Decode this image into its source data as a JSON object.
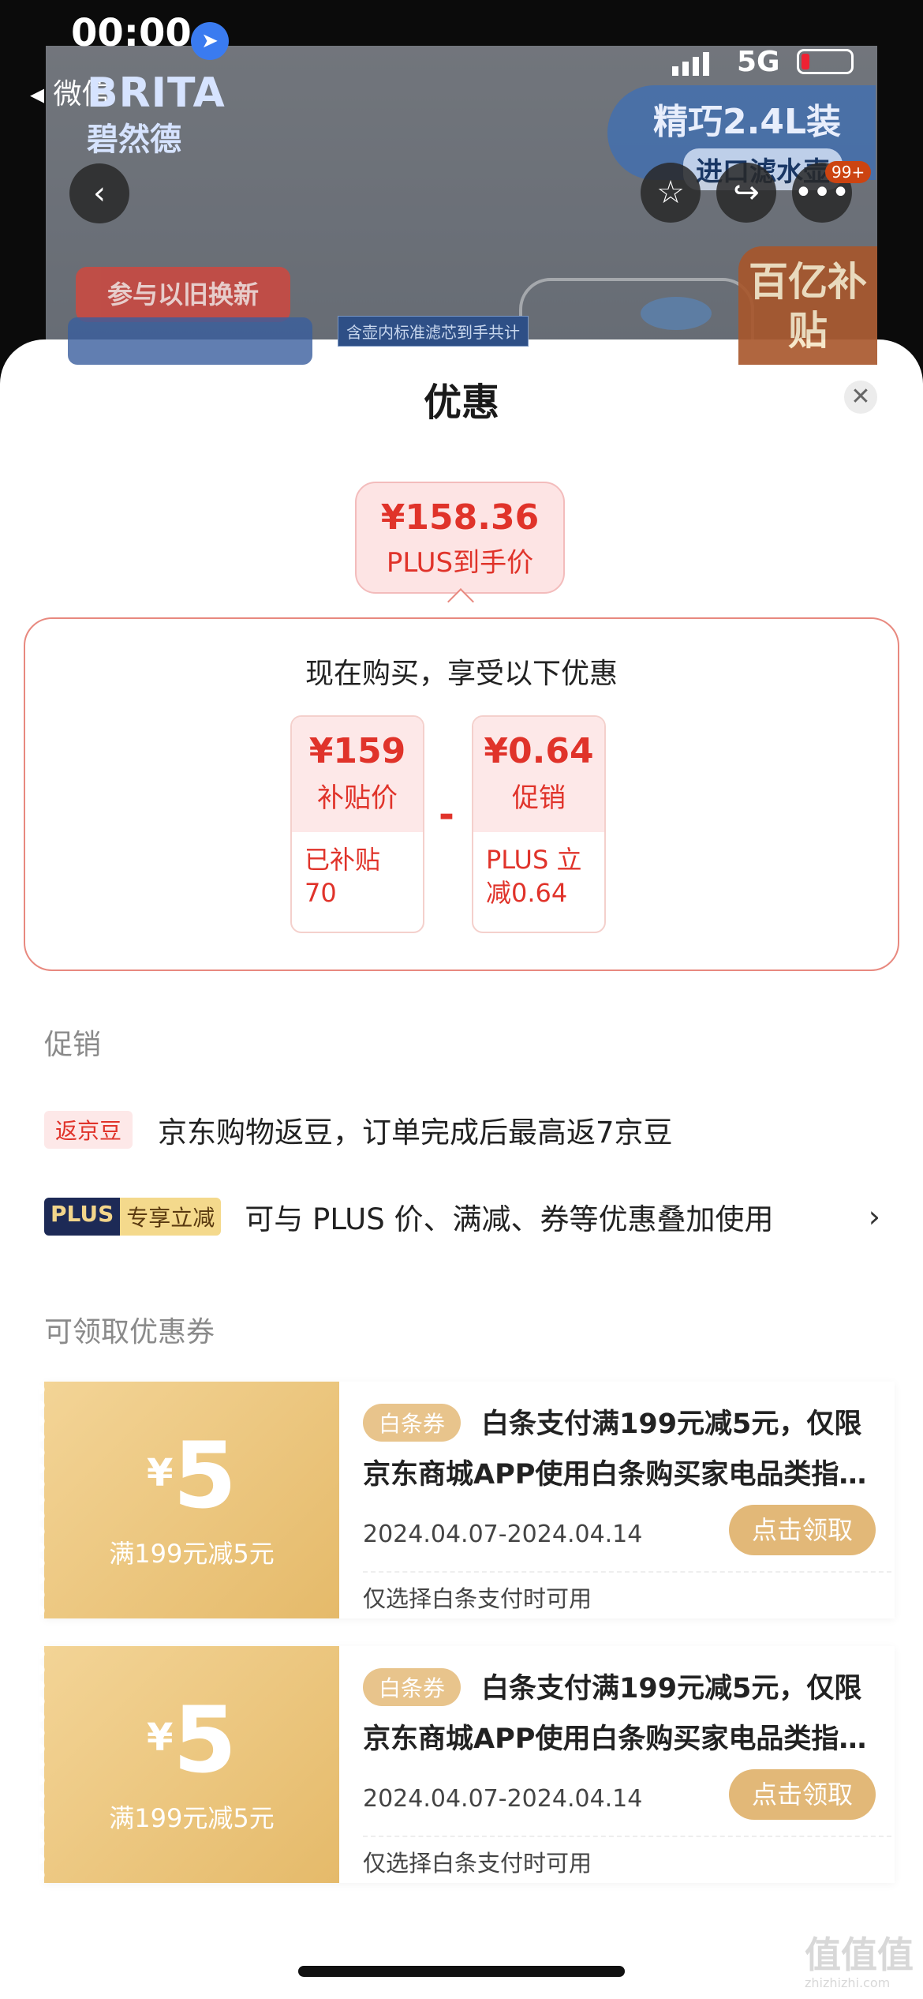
{
  "status_bar": {
    "time": "00:00",
    "back_app": "微信",
    "network": "5G"
  },
  "product": {
    "brand_en": "BRITA",
    "brand_cn": "碧然德",
    "promo_line1": "精巧2.4L装",
    "promo_line2": "进口滤水壶",
    "tradein": "参与以旧换新",
    "filter_note": "含壶内标准滤芯到手共计",
    "subsidy": "百亿补贴",
    "badge_count": "99+"
  },
  "sheet": {
    "title": "优惠",
    "final_price": "¥158.36",
    "final_label": "PLUS到手价",
    "detail_heading": "现在购买，享受以下优惠",
    "minus": "-",
    "tickets": [
      {
        "value": "¥159",
        "label": "补贴价",
        "note": "已补贴70"
      },
      {
        "value": "¥0.64",
        "label": "促销",
        "note": "PLUS 立减0.64"
      }
    ],
    "promo_section": "促销",
    "promo_rows": [
      {
        "tag": "返京豆",
        "text": "京东购物返豆，订单完成后最高返7京豆"
      },
      {
        "tag_a": "PLUS",
        "tag_b": "专享立减",
        "text": "可与 PLUS 价、满减、券等优惠叠加使用",
        "arrow": "›"
      }
    ],
    "coupon_section": "可领取优惠券",
    "coupons": [
      {
        "currency": "¥",
        "amount": "5",
        "condition": "满199元减5元",
        "badge": "白条券",
        "desc": "白条支付满199元减5元，仅限京东商城APP使用白条购买家电品类指定商品",
        "date": "2024.04.07-2024.04.14",
        "button": "点击领取",
        "note": "仅选择白条支付时可用"
      },
      {
        "currency": "¥",
        "amount": "5",
        "condition": "满199元减5元",
        "badge": "白条券",
        "desc": "白条支付满199元减5元，仅限京东商城APP使用白条购买家电品类指定商品",
        "date": "2024.04.07-2024.04.14",
        "button": "点击领取",
        "note": "仅选择白条支付时可用"
      }
    ]
  },
  "watermark": {
    "main": "值值值",
    "sub": "zhizhizhi.com"
  },
  "colors": {
    "accent_red": "#e0332a",
    "coupon_gold": "#e2b878",
    "plus_navy": "#1d2a56"
  }
}
